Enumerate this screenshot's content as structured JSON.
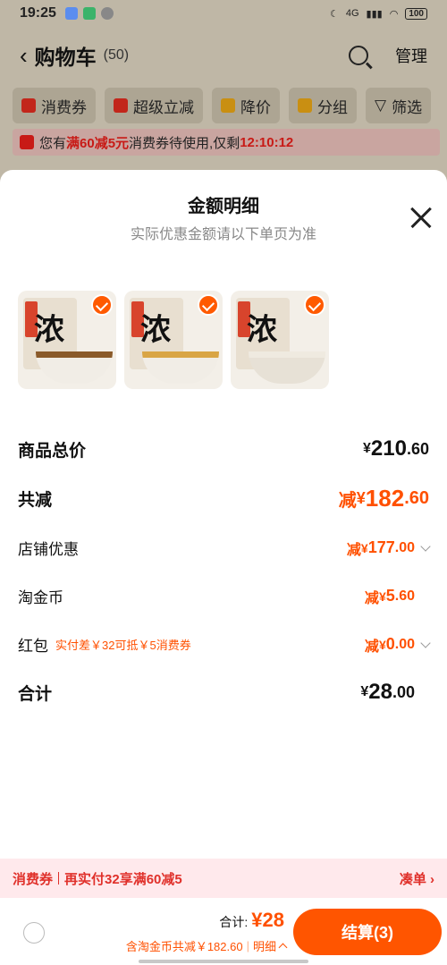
{
  "status_bar": {
    "time": "19:25",
    "network": "4G",
    "battery": "100"
  },
  "cart_header": {
    "title": "购物车",
    "count": "(50)",
    "manage": "管理"
  },
  "filters": [
    "消费券",
    "超级立减",
    "降价",
    "分组",
    "筛选"
  ],
  "promo_banner": {
    "prefix": "您有",
    "highlight": "满60减5元",
    "middle": "消费券待使用,仅剩",
    "countdown": "12:10:12"
  },
  "sheet": {
    "title": "金额明细",
    "subtitle": "实际优惠金额请以下单页为准",
    "products": [
      {
        "package_char": "浓",
        "selected": true
      },
      {
        "package_char": "浓",
        "selected": true
      },
      {
        "package_char": "浓",
        "selected": true
      }
    ],
    "rows": [
      {
        "label": "商品总价",
        "prefix": "",
        "currency": "¥",
        "int": "210",
        "dec": ".60",
        "note": "",
        "chevron": false
      },
      {
        "label": "共减",
        "prefix": "减",
        "currency": "¥",
        "int": "182",
        "dec": ".60",
        "note": "",
        "chevron": false
      },
      {
        "label": "店铺优惠",
        "prefix": "减",
        "currency": "¥",
        "int": "177",
        "dec": ".00",
        "note": "",
        "chevron": true
      },
      {
        "label": "淘金币",
        "prefix": "减",
        "currency": "¥",
        "int": "5",
        "dec": ".60",
        "note": "",
        "chevron": false
      },
      {
        "label": "红包",
        "prefix": "减",
        "currency": "¥",
        "int": "0",
        "dec": ".00",
        "note": "实付差￥32可抵￥5消费券",
        "chevron": true
      },
      {
        "label": "合计",
        "prefix": "",
        "currency": "¥",
        "int": "28",
        "dec": ".00",
        "note": "",
        "chevron": false
      }
    ]
  },
  "coupon_bar": {
    "label": "消费券",
    "message": "再实付32享满60减5",
    "action": "凑单"
  },
  "footer": {
    "total_label": "合计:",
    "total_value": "¥28",
    "discount_text": "含淘金币共减￥182.60",
    "detail_link": "明细",
    "checkout": "结算(3)"
  },
  "colors": {
    "accent": "#ff5000",
    "coupon_red": "#e0302a",
    "checkout_bg": "#ff5500"
  }
}
